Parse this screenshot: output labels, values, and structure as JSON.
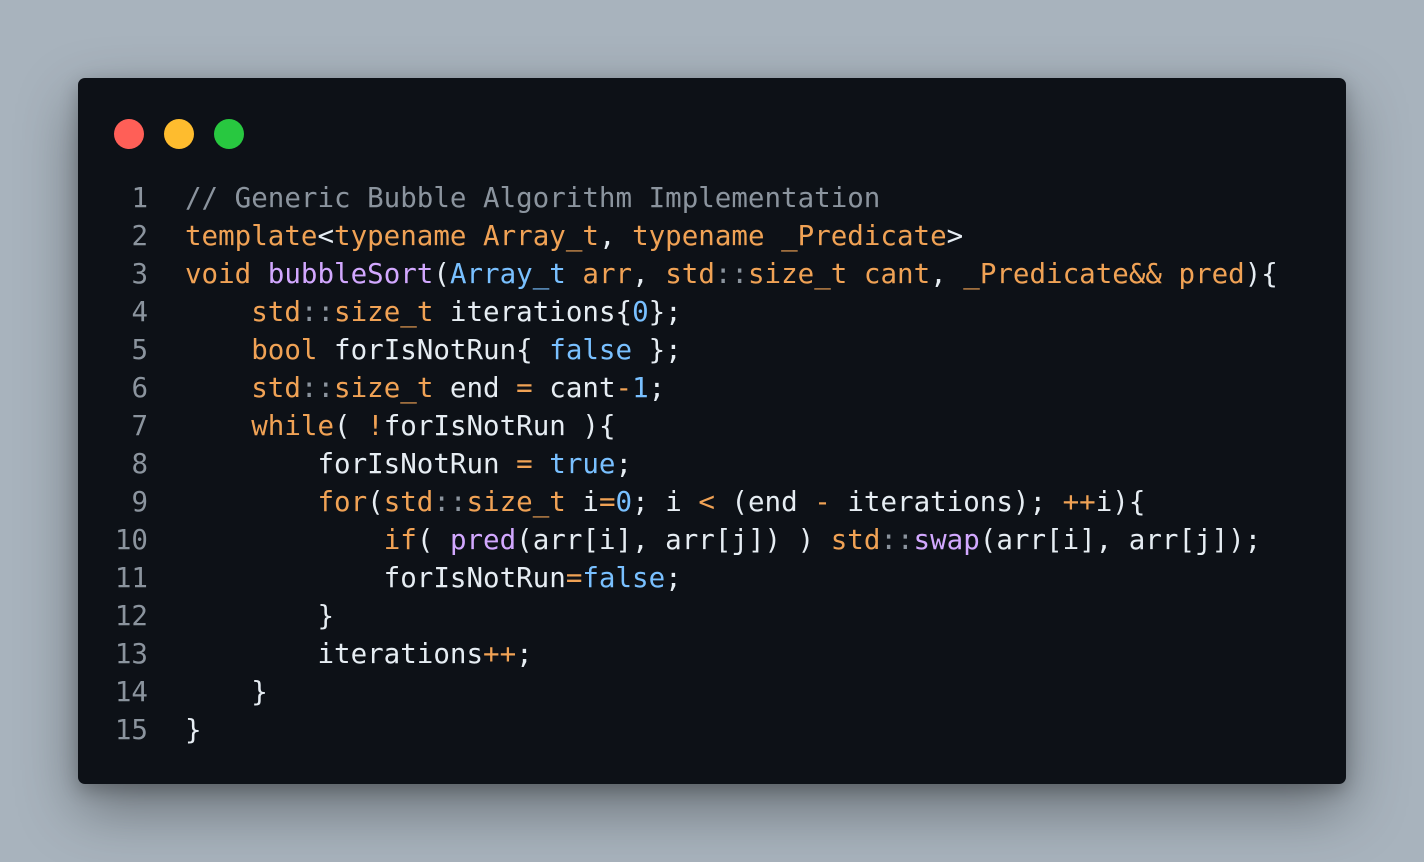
{
  "window_controls": {
    "close_color": "#ff5f57",
    "minimize_color": "#febc2e",
    "maximize_color": "#28c840"
  },
  "code": {
    "language": "cpp",
    "lines": [
      {
        "number": "1",
        "tokens": [
          {
            "t": "// Generic Bubble Algorithm Implementation",
            "c": "comment"
          }
        ]
      },
      {
        "number": "2",
        "tokens": [
          {
            "t": "template",
            "c": "keyword"
          },
          {
            "t": "<",
            "c": "plain"
          },
          {
            "t": "typename",
            "c": "keyword"
          },
          {
            "t": " ",
            "c": "plain"
          },
          {
            "t": "Array_t",
            "c": "type"
          },
          {
            "t": ", ",
            "c": "plain"
          },
          {
            "t": "typename",
            "c": "keyword"
          },
          {
            "t": " ",
            "c": "plain"
          },
          {
            "t": "_Predicate",
            "c": "type"
          },
          {
            "t": ">",
            "c": "plain"
          }
        ]
      },
      {
        "number": "3",
        "tokens": [
          {
            "t": "void",
            "c": "keyword"
          },
          {
            "t": " ",
            "c": "plain"
          },
          {
            "t": "bubbleSort",
            "c": "fn"
          },
          {
            "t": "(",
            "c": "plain"
          },
          {
            "t": "Array_t",
            "c": "tname"
          },
          {
            "t": " ",
            "c": "plain"
          },
          {
            "t": "arr",
            "c": "param"
          },
          {
            "t": ", ",
            "c": "plain"
          },
          {
            "t": "std",
            "c": "ns"
          },
          {
            "t": "::",
            "c": "sep"
          },
          {
            "t": "size_t",
            "c": "type"
          },
          {
            "t": " ",
            "c": "plain"
          },
          {
            "t": "cant",
            "c": "param"
          },
          {
            "t": ", ",
            "c": "plain"
          },
          {
            "t": "_Predicate&&",
            "c": "type"
          },
          {
            "t": " ",
            "c": "plain"
          },
          {
            "t": "pred",
            "c": "param"
          },
          {
            "t": "){",
            "c": "plain"
          }
        ]
      },
      {
        "number": "4",
        "tokens": [
          {
            "t": "    ",
            "c": "plain"
          },
          {
            "t": "std",
            "c": "ns"
          },
          {
            "t": "::",
            "c": "sep"
          },
          {
            "t": "size_t",
            "c": "type"
          },
          {
            "t": " iterations{",
            "c": "plain"
          },
          {
            "t": "0",
            "c": "num"
          },
          {
            "t": "};",
            "c": "plain"
          }
        ]
      },
      {
        "number": "5",
        "tokens": [
          {
            "t": "    ",
            "c": "plain"
          },
          {
            "t": "bool",
            "c": "keyword"
          },
          {
            "t": " forIsNotRun{ ",
            "c": "plain"
          },
          {
            "t": "false",
            "c": "lit"
          },
          {
            "t": " };",
            "c": "plain"
          }
        ]
      },
      {
        "number": "6",
        "tokens": [
          {
            "t": "    ",
            "c": "plain"
          },
          {
            "t": "std",
            "c": "ns"
          },
          {
            "t": "::",
            "c": "sep"
          },
          {
            "t": "size_t",
            "c": "type"
          },
          {
            "t": " end ",
            "c": "plain"
          },
          {
            "t": "=",
            "c": "op"
          },
          {
            "t": " cant",
            "c": "plain"
          },
          {
            "t": "-",
            "c": "op"
          },
          {
            "t": "1",
            "c": "num"
          },
          {
            "t": ";",
            "c": "plain"
          }
        ]
      },
      {
        "number": "7",
        "tokens": [
          {
            "t": "    ",
            "c": "plain"
          },
          {
            "t": "while",
            "c": "keyword"
          },
          {
            "t": "( ",
            "c": "plain"
          },
          {
            "t": "!",
            "c": "op"
          },
          {
            "t": "forIsNotRun ){",
            "c": "plain"
          }
        ]
      },
      {
        "number": "8",
        "tokens": [
          {
            "t": "        forIsNotRun ",
            "c": "plain"
          },
          {
            "t": "=",
            "c": "op"
          },
          {
            "t": " ",
            "c": "plain"
          },
          {
            "t": "true",
            "c": "lit"
          },
          {
            "t": ";",
            "c": "plain"
          }
        ]
      },
      {
        "number": "9",
        "tokens": [
          {
            "t": "        ",
            "c": "plain"
          },
          {
            "t": "for",
            "c": "keyword"
          },
          {
            "t": "(",
            "c": "plain"
          },
          {
            "t": "std",
            "c": "ns"
          },
          {
            "t": "::",
            "c": "sep"
          },
          {
            "t": "size_t",
            "c": "type"
          },
          {
            "t": " i",
            "c": "plain"
          },
          {
            "t": "=",
            "c": "op"
          },
          {
            "t": "0",
            "c": "num"
          },
          {
            "t": "; i ",
            "c": "plain"
          },
          {
            "t": "<",
            "c": "op"
          },
          {
            "t": " (end ",
            "c": "plain"
          },
          {
            "t": "-",
            "c": "op"
          },
          {
            "t": " iterations); ",
            "c": "plain"
          },
          {
            "t": "++",
            "c": "op"
          },
          {
            "t": "i){",
            "c": "plain"
          }
        ]
      },
      {
        "number": "10",
        "tokens": [
          {
            "t": "            ",
            "c": "plain"
          },
          {
            "t": "if",
            "c": "keyword"
          },
          {
            "t": "( ",
            "c": "plain"
          },
          {
            "t": "pred",
            "c": "fn"
          },
          {
            "t": "(arr[i], arr[j]) ) ",
            "c": "plain"
          },
          {
            "t": "std",
            "c": "ns"
          },
          {
            "t": "::",
            "c": "sep"
          },
          {
            "t": "swap",
            "c": "fn"
          },
          {
            "t": "(arr[i], arr[j]);",
            "c": "plain"
          }
        ]
      },
      {
        "number": "11",
        "tokens": [
          {
            "t": "            forIsNotRun",
            "c": "plain"
          },
          {
            "t": "=",
            "c": "op"
          },
          {
            "t": "false",
            "c": "lit"
          },
          {
            "t": ";",
            "c": "plain"
          }
        ]
      },
      {
        "number": "12",
        "tokens": [
          {
            "t": "        }",
            "c": "plain"
          }
        ]
      },
      {
        "number": "13",
        "tokens": [
          {
            "t": "        iterations",
            "c": "plain"
          },
          {
            "t": "++",
            "c": "op"
          },
          {
            "t": ";",
            "c": "plain"
          }
        ]
      },
      {
        "number": "14",
        "tokens": [
          {
            "t": "    }",
            "c": "plain"
          }
        ]
      },
      {
        "number": "15",
        "tokens": [
          {
            "t": "}",
            "c": "plain"
          }
        ]
      }
    ]
  }
}
